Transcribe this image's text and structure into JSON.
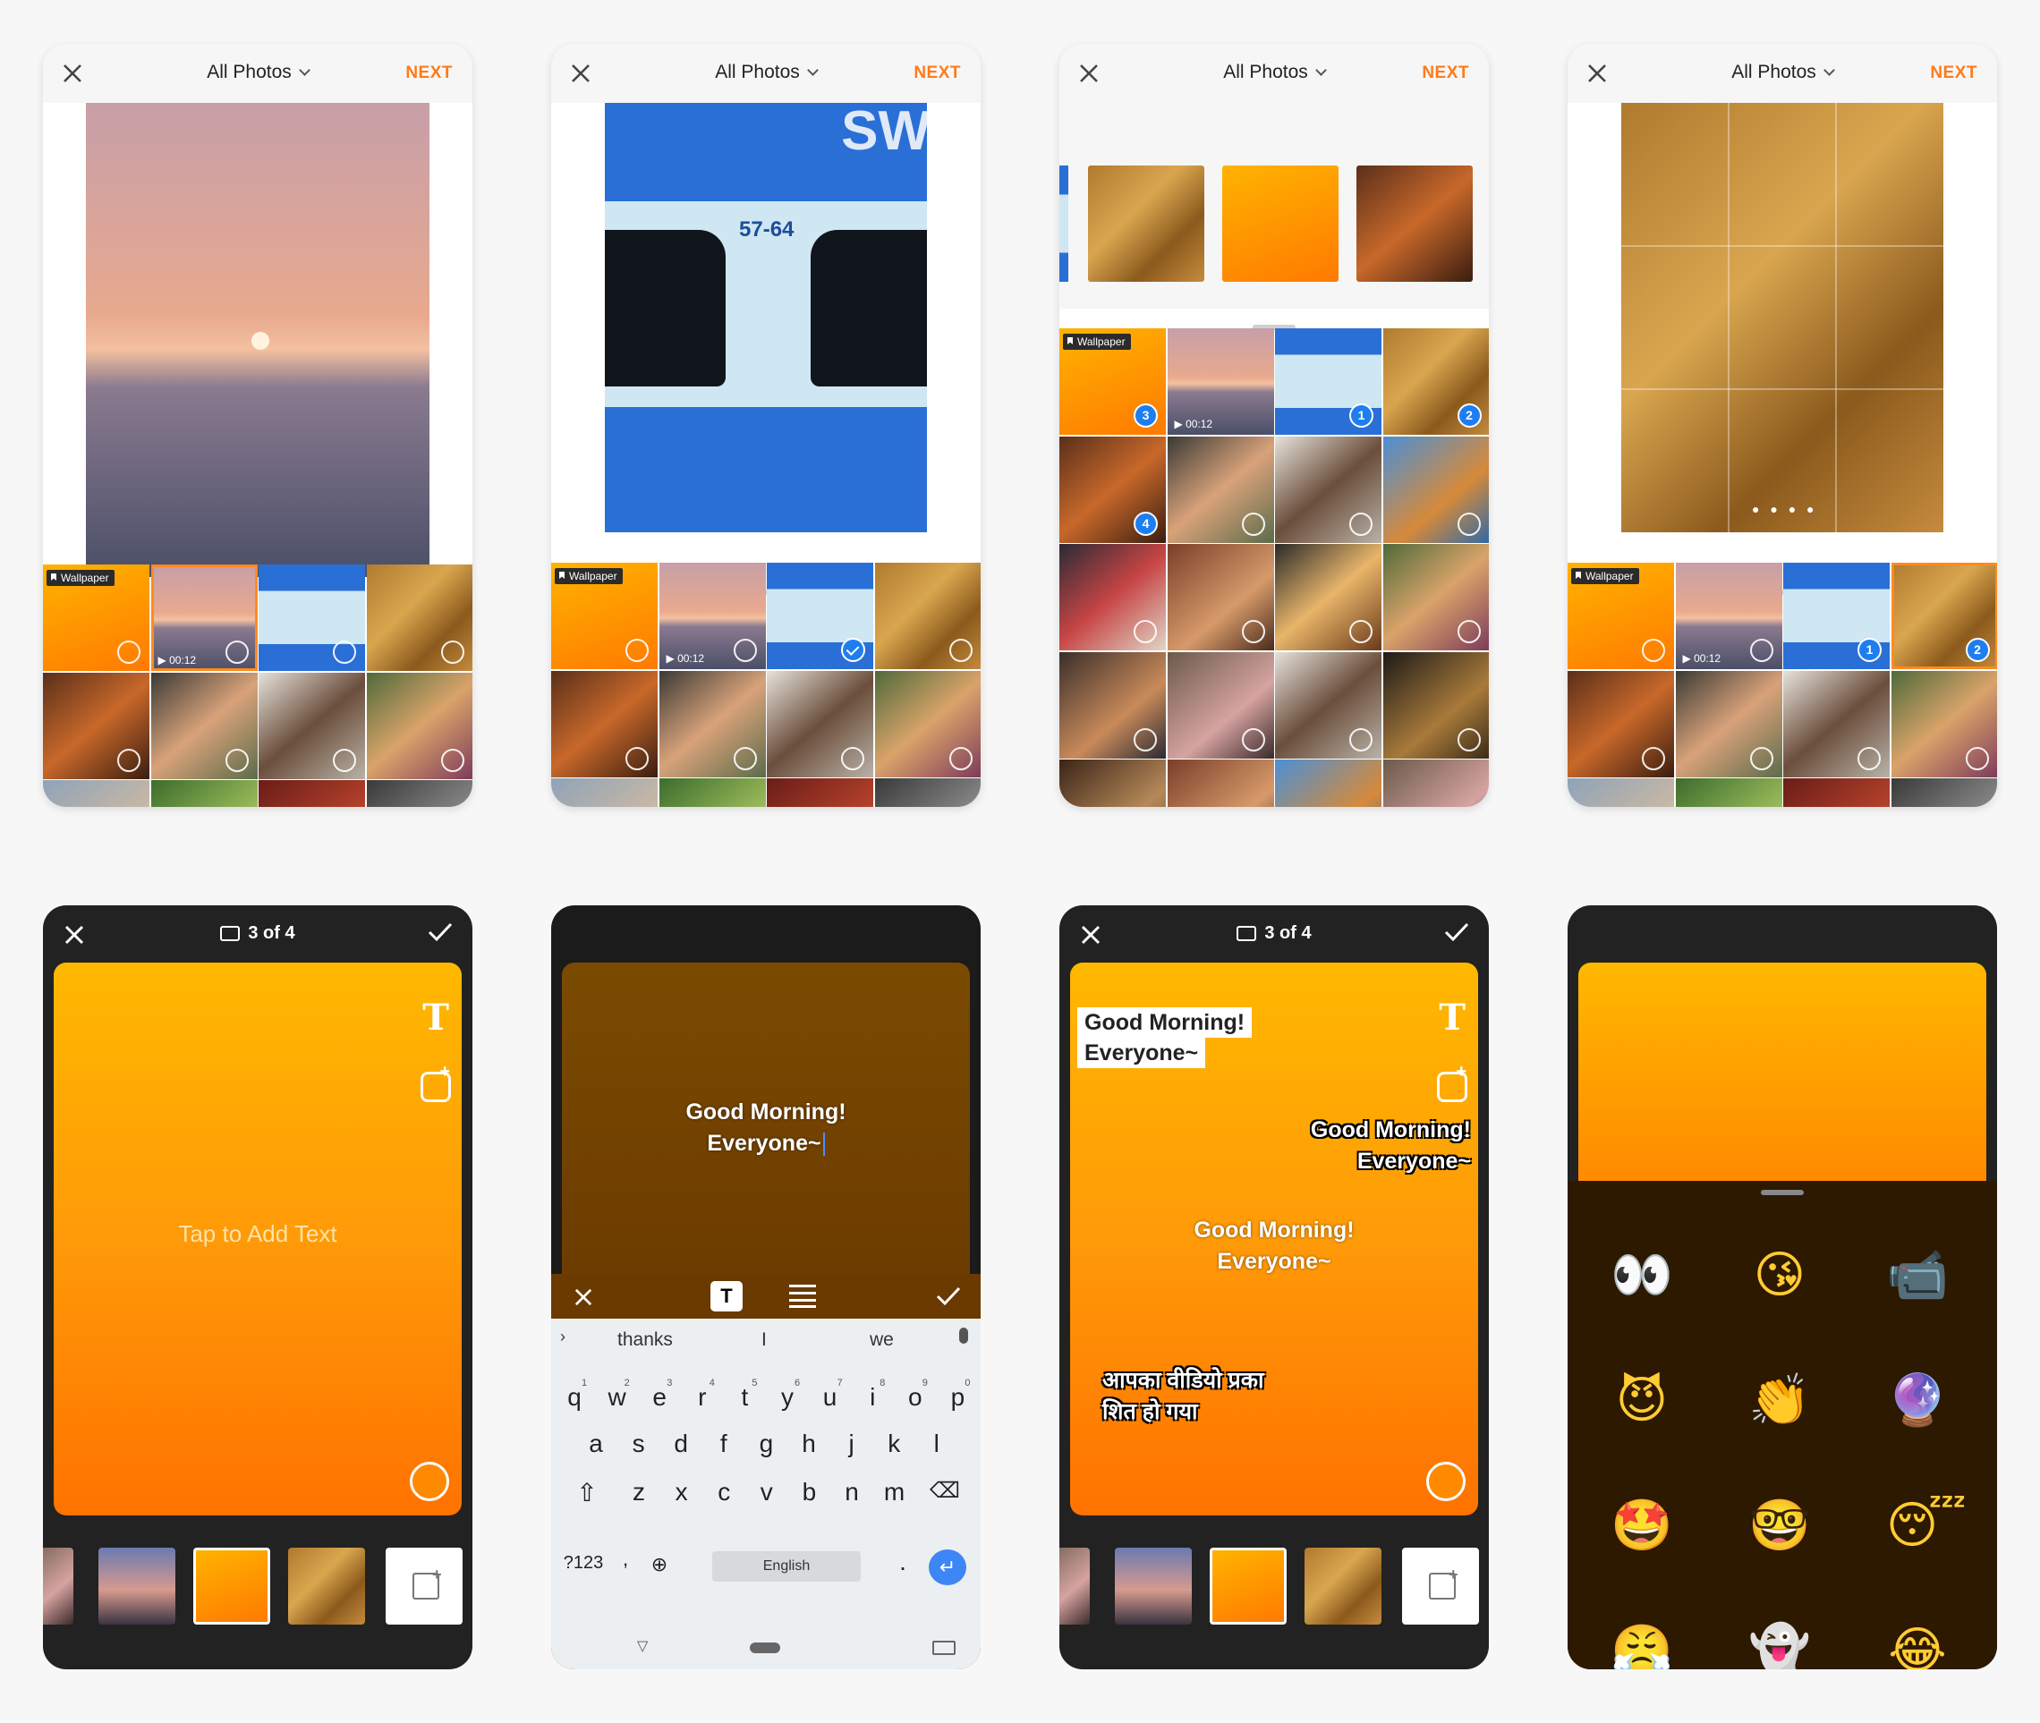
{
  "picker": {
    "title": "All Photos",
    "next_label": "NEXT",
    "wallpaper_tag": "Wallpaper",
    "video_duration": "00:12",
    "train_text": "SW",
    "train_number": "57-64",
    "swr": "SWR",
    "badges": {
      "first": "1",
      "second": "2",
      "third": "3",
      "fourth": "4"
    }
  },
  "editor": {
    "counter": "3 of 4",
    "placeholder": "Tap to Add Text",
    "text_line1": "Good Morning!",
    "text_line2": "Everyone~",
    "hindi_line1": "आपका वीडियो प्रका",
    "hindi_line2": "शित हो गया"
  },
  "keyboard": {
    "suggestions": [
      "thanks",
      "I",
      "we"
    ],
    "row1": [
      "q",
      "w",
      "e",
      "r",
      "t",
      "y",
      "u",
      "i",
      "o",
      "p"
    ],
    "row1_hints": [
      "1",
      "2",
      "3",
      "4",
      "5",
      "6",
      "7",
      "8",
      "9",
      "0"
    ],
    "row2": [
      "a",
      "s",
      "d",
      "f",
      "g",
      "h",
      "j",
      "k",
      "l"
    ],
    "row3": [
      "z",
      "x",
      "c",
      "v",
      "b",
      "n",
      "m"
    ],
    "symbols_label": "?123",
    "space_label": "English",
    "period": ".",
    "comma": ","
  },
  "emoji": {
    "items": [
      "👀",
      "😘",
      "📹",
      "😈",
      "👏",
      "🔮",
      "🤩",
      "🤓",
      "😴",
      "😤",
      "👻",
      "😂"
    ]
  },
  "colors": {
    "accent": "#ff7a1a",
    "blue": "#1e7ef0",
    "orange_start": "#ffb800",
    "orange_end": "#ff7200"
  }
}
